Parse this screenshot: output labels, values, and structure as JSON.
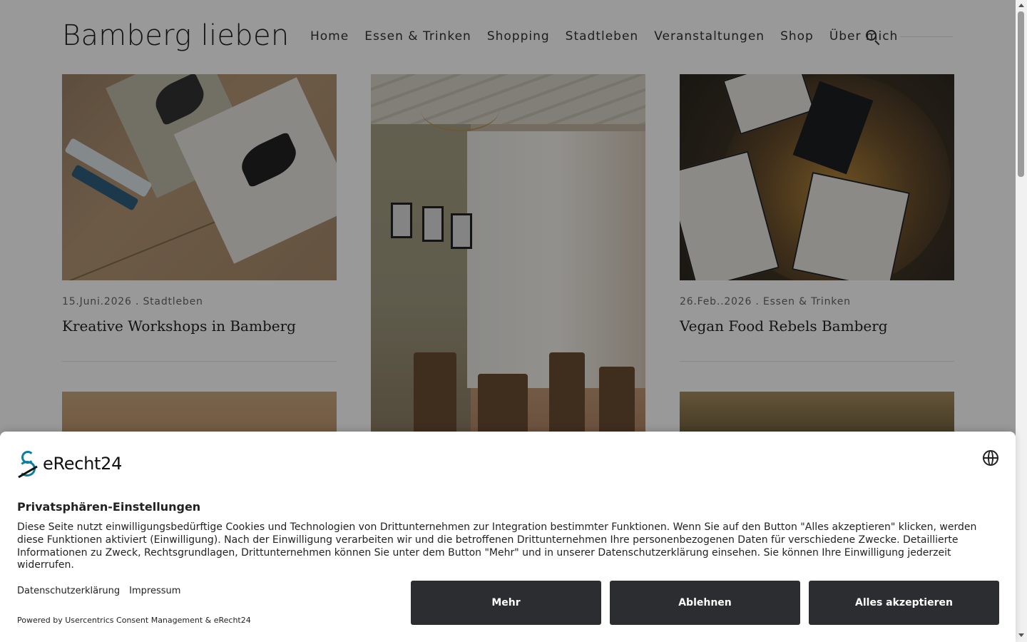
{
  "site": {
    "logo": "Bamberg lieben",
    "nav": [
      "Home",
      "Essen & Trinken",
      "Shopping",
      "Stadtleben",
      "Veranstaltungen",
      "Shop",
      "Über mich"
    ]
  },
  "posts": [
    {
      "date_category": "15.Juni.2026 . Stadtleben",
      "title": "Kreative Workshops in Bamberg"
    },
    {
      "date_category": "26.Feb..2026 . Essen & Trinken",
      "title": "Vegan Food Rebels Bamberg"
    }
  ],
  "consent": {
    "brand": "eRecht24",
    "title": "Privatsphären-Einstellungen",
    "body": "Diese Seite nutzt einwilligungsbedürftige Cookies und Technologien von Drittunternehmen zur Integration bestimmter Funktionen. Wenn Sie auf den Button \"Alles akzeptieren\" klicken, werden diese Funktionen aktiviert (Einwilligung). Nach der Einwilligung verarbeiten wir und die betroffenen Drittunternehmen Ihre personenbezogenen Daten für verschiedene Zwecke. Detaillierte Informationen zu Zweck, Rechtsgrundlagen, Drittunternehmen können Sie unter dem Button \"Mehr\" und in unserer Datenschutzerklärung einsehen. Sie können Ihre Einwilligung jederzeit widerrufen.",
    "link_privacy": "Datenschutzerklärung",
    "link_imprint": "Impressum",
    "powered": "Powered by Usercentrics Consent Management & eRecht24",
    "btn_more": "Mehr",
    "btn_deny": "Ablehnen",
    "btn_accept": "Alles akzeptieren"
  },
  "icons": {
    "search": "search-icon",
    "globe": "globe-icon",
    "brand": "erecht24-logo-icon"
  },
  "colors": {
    "button_bg": "#2b2d31",
    "overlay": "rgba(0,0,0,0.4)",
    "brand_accent": "#0e7e9c"
  }
}
